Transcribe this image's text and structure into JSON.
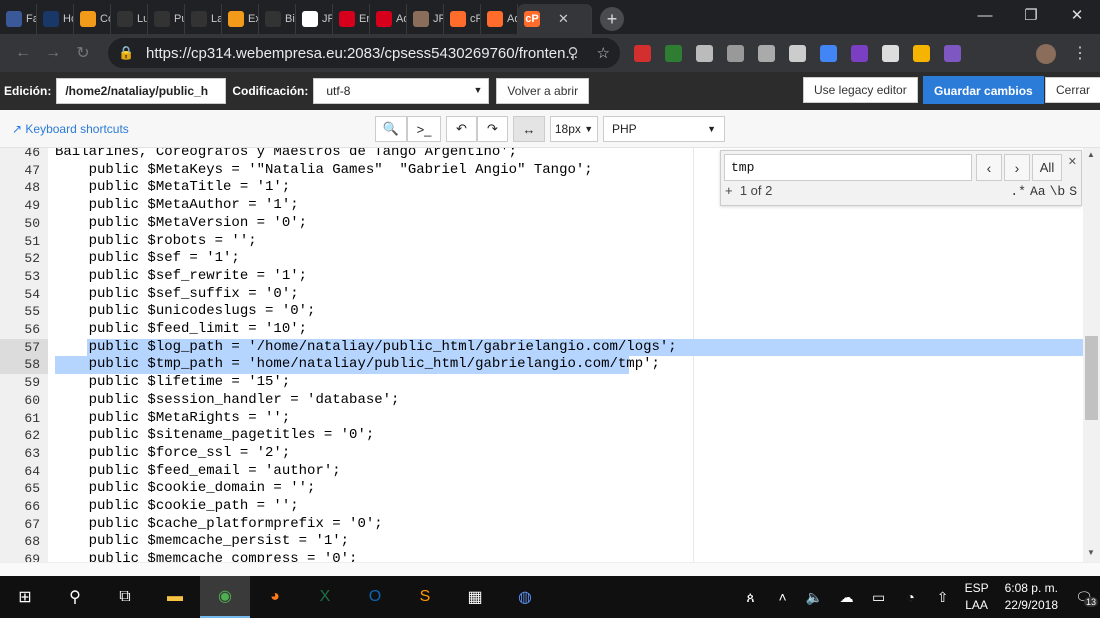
{
  "browser": {
    "tabs": [
      {
        "label": "Fac",
        "icon": "facebook-icon",
        "color": "#3b5998"
      },
      {
        "label": "Ho",
        "icon": "joomla-icon",
        "color": "#1a3867"
      },
      {
        "label": "Cor",
        "icon": "joomla-x-icon",
        "color": "#f29b1b"
      },
      {
        "label": "Lur",
        "icon": "slides-icon",
        "color": "#333333"
      },
      {
        "label": "Pu",
        "icon": "slides-icon",
        "color": "#333333"
      },
      {
        "label": "Lan",
        "icon": "mountain-icon",
        "color": "#333333"
      },
      {
        "label": "Ext",
        "icon": "joomla-x-icon",
        "color": "#f29b1b"
      },
      {
        "label": "Bie",
        "icon": "slides-icon",
        "color": "#333333"
      },
      {
        "label": "JFo",
        "icon": "google-icon",
        "color": "#ffffff"
      },
      {
        "label": "En",
        "icon": "webempresa-icon",
        "color": "#d6001c"
      },
      {
        "label": "Adv",
        "icon": "webempresa-icon",
        "color": "#d6001c"
      },
      {
        "label": "JFo",
        "icon": "avatar-icon",
        "color": "#8a6d5a"
      },
      {
        "label": "cPa",
        "icon": "cpanel-icon",
        "color": "#ff6c2c"
      },
      {
        "label": "Adr",
        "icon": "cpanel-icon",
        "color": "#ff6c2c"
      }
    ],
    "url": "https://cp314.webempresa.eu:2083/cpsess5430269760/fronten...",
    "extension_colors": [
      "#d32f2f",
      "#2e7d32",
      "#bbbbbb",
      "#999999",
      "#aaaaaa",
      "#cccccc",
      "#4285f4",
      "#7b3fc4",
      "#dddddd",
      "#f4b400",
      "#7e57c2"
    ]
  },
  "editor_toolbar": {
    "edicion_label": "Edición:",
    "path_value": "/home2/nataliay/public_h",
    "codificacion_label": "Codificación:",
    "encoding_value": "utf-8",
    "reopen_label": "Volver a abrir",
    "legacy_label": "Use legacy editor",
    "save_label": "Guardar cambios",
    "close_label": "Cerrar"
  },
  "tool_row": {
    "shortcuts_label": "Keyboard shortcuts",
    "font_size": "18px",
    "mode": "PHP"
  },
  "search": {
    "query": "tmp",
    "all_label": "All",
    "count": "1 of 2",
    "opts": [
      ".*",
      "Aa",
      "\\b",
      "S"
    ]
  },
  "code_lines": [
    {
      "n": "46",
      "text": "Bailarines, Coreógrafos y Maestros de Tango Argentino';"
    },
    {
      "n": "47",
      "text": "    public $MetaKeys = '\"Natalia Games\"  \"Gabriel Angio\" Tango';"
    },
    {
      "n": "48",
      "text": "    public $MetaTitle = '1';"
    },
    {
      "n": "49",
      "text": "    public $MetaAuthor = '1';"
    },
    {
      "n": "50",
      "text": "    public $MetaVersion = '0';"
    },
    {
      "n": "51",
      "text": "    public $robots = '';"
    },
    {
      "n": "52",
      "text": "    public $sef = '1';"
    },
    {
      "n": "53",
      "text": "    public $sef_rewrite = '1';"
    },
    {
      "n": "54",
      "text": "    public $sef_suffix = '0';"
    },
    {
      "n": "55",
      "text": "    public $unicodeslugs = '0';"
    },
    {
      "n": "56",
      "text": "    public $feed_limit = '10';"
    },
    {
      "n": "57",
      "text": "    public $log_path = '/home/nataliay/public_html/gabrielangio.com/logs';"
    },
    {
      "n": "58",
      "text": "    public $tmp_path = 'home/nataliay/public_html/gabrielangio.com/tmp';"
    },
    {
      "n": "59",
      "text": "    public $lifetime = '15';"
    },
    {
      "n": "60",
      "text": "    public $session_handler = 'database';"
    },
    {
      "n": "61",
      "text": "    public $MetaRights = '';"
    },
    {
      "n": "62",
      "text": "    public $sitename_pagetitles = '0';"
    },
    {
      "n": "63",
      "text": "    public $force_ssl = '2';"
    },
    {
      "n": "64",
      "text": "    public $feed_email = 'author';"
    },
    {
      "n": "65",
      "text": "    public $cookie_domain = '';"
    },
    {
      "n": "66",
      "text": "    public $cookie_path = '';"
    },
    {
      "n": "67",
      "text": "    public $cache_platformprefix = '0';"
    },
    {
      "n": "68",
      "text": "    public $memcache_persist = '1';"
    },
    {
      "n": "69",
      "text": "    public $memcache_compress = '0';"
    }
  ],
  "taskbar": {
    "apps": [
      "windows-icon",
      "search-icon",
      "task-view-icon",
      "file-explorer-icon",
      "chrome-icon",
      "firefox-icon",
      "excel-icon",
      "outlook-icon",
      "sublime-icon",
      "calendar-icon",
      "chromium-icon"
    ],
    "lang_top": "ESP",
    "lang_bottom": "LAA",
    "time": "6:08 p. m.",
    "date": "22/9/2018",
    "notif_count": "13"
  }
}
